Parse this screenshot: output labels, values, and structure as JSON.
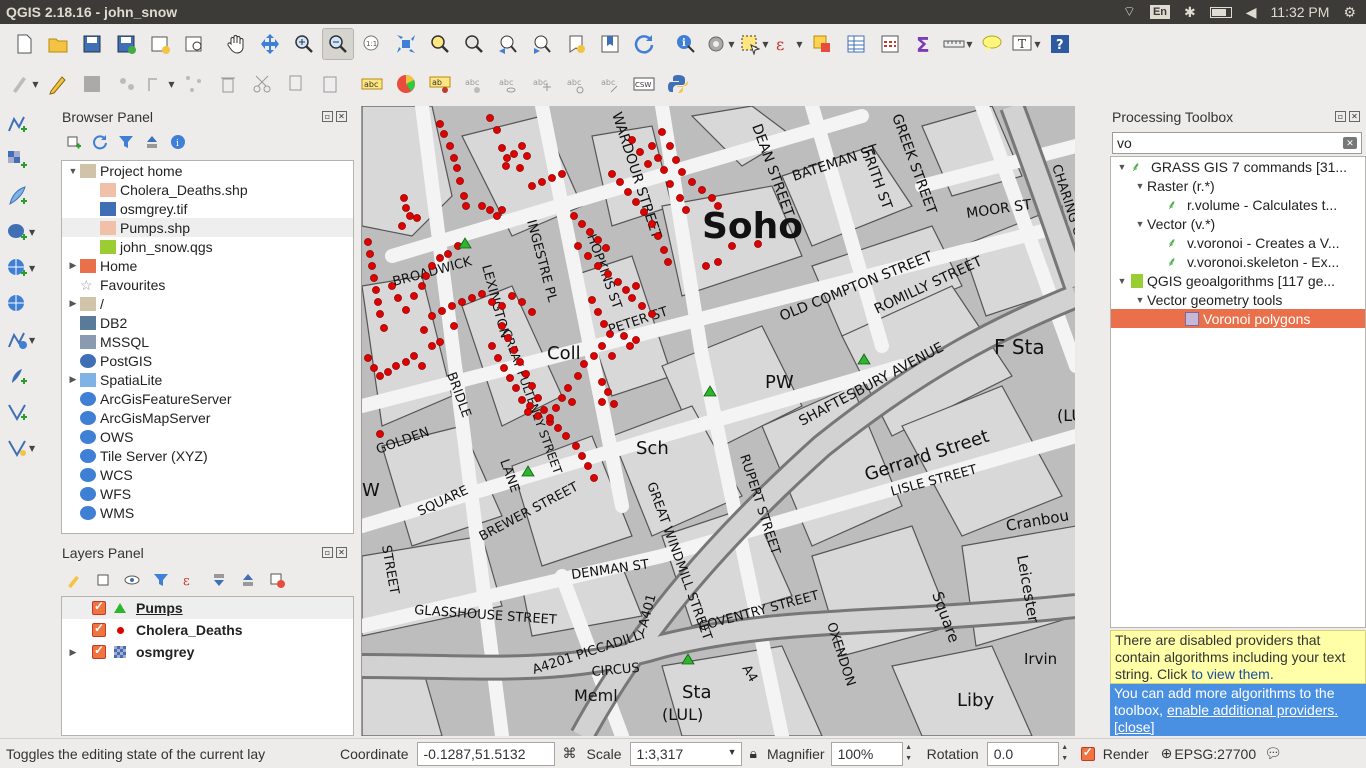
{
  "window": {
    "title": "QGIS 2.18.16 - john_snow"
  },
  "system_tray": {
    "language": "En",
    "clock": "11:32 PM"
  },
  "browser_panel": {
    "title": "Browser Panel",
    "items": [
      {
        "label": "Project home",
        "expander": "▼",
        "icon": "folder-icon"
      },
      {
        "label": "Cholera_Deaths.shp",
        "icon": "polygon-layer-icon",
        "indent": 2
      },
      {
        "label": "osmgrey.tif",
        "icon": "raster-icon",
        "indent": 2
      },
      {
        "label": "Pumps.shp",
        "icon": "polygon-layer-icon",
        "indent": 2,
        "selected": true
      },
      {
        "label": "john_snow.qgs",
        "icon": "qgis-project-icon",
        "indent": 2
      },
      {
        "label": "Home",
        "expander": "▶",
        "icon": "home-folder-icon"
      },
      {
        "label": "Favourites",
        "icon": "star-icon"
      },
      {
        "label": "/",
        "expander": "▶",
        "icon": "folder-icon"
      },
      {
        "label": "DB2",
        "icon": "db2-icon"
      },
      {
        "label": "MSSQL",
        "icon": "mssql-icon"
      },
      {
        "label": "PostGIS",
        "icon": "postgis-icon"
      },
      {
        "label": "SpatiaLite",
        "expander": "▶",
        "icon": "spatialite-icon"
      },
      {
        "label": "ArcGisFeatureServer",
        "icon": "globe-icon"
      },
      {
        "label": "ArcGisMapServer",
        "icon": "globe-icon"
      },
      {
        "label": "OWS",
        "icon": "globe-icon"
      },
      {
        "label": "Tile Server (XYZ)",
        "icon": "globe-icon"
      },
      {
        "label": "WCS",
        "icon": "globe-icon"
      },
      {
        "label": "WFS",
        "icon": "globe-icon"
      },
      {
        "label": "WMS",
        "icon": "globe-icon"
      }
    ]
  },
  "layers_panel": {
    "title": "Layers Panel",
    "layers": [
      {
        "label": "Pumps",
        "symbol": "green-triangle",
        "expander": ""
      },
      {
        "label": "Cholera_Deaths",
        "symbol": "red-dot",
        "expander": ""
      },
      {
        "label": "osmgrey",
        "symbol": "raster",
        "expander": "▶"
      }
    ]
  },
  "map": {
    "labels": [
      "Soho",
      "MOOR ST",
      "BATEMAN ST",
      "FRITH ST",
      "GREEK STREET",
      "DEAN STREET",
      "WARDOUR STREET",
      "OLD COMPTON STREET",
      "ROMILLY STREET",
      "SHAFTESBURY AVENUE",
      "Gerrard Street",
      "LISLE STREET",
      "F Sta",
      "PW",
      "Coll",
      "Sch",
      "Cranbou",
      "Leicester",
      "Square",
      "Irvin",
      "Liby",
      "BROADWICK",
      "GOLDEN",
      "SQUARE",
      "BRIDLE",
      "LANE",
      "BREWER STREET",
      "GREAT WINDMILL STREET",
      "RUPERT STREET",
      "DENMAN ST",
      "GLASSHOUSE STREET",
      "A4201 PICCADILLY",
      "CIRCUS",
      "COVENTRY STREET",
      "OXENDON",
      "A401",
      "A4",
      "Meml",
      "Sta",
      "(LUL)",
      "PETER ST",
      "HOPKINS ST",
      "INGESTRE PL",
      "LEXINGTON",
      "GREAT PULTENEY STREET",
      "CHARING CR",
      "W",
      "STREET",
      "(LU"
    ]
  },
  "processing_toolbox": {
    "title": "Processing Toolbox",
    "search_value": "vo",
    "tree": [
      {
        "label": "GRASS GIS 7 commands [31...",
        "expander": "▼",
        "level": 0,
        "icon": "grass-icon"
      },
      {
        "label": "Raster (r.*)",
        "expander": "▼",
        "level": 1
      },
      {
        "label": "r.volume - Calculates t...",
        "level": 2,
        "icon": "grass-icon"
      },
      {
        "label": "Vector (v.*)",
        "expander": "▼",
        "level": 1
      },
      {
        "label": "v.voronoi - Creates a V...",
        "level": 2,
        "icon": "grass-icon"
      },
      {
        "label": "v.voronoi.skeleton - Ex...",
        "level": 2,
        "icon": "grass-icon"
      },
      {
        "label": "QGIS geoalgorithms [117 ge...",
        "expander": "▼",
        "level": 0,
        "icon": "qgis-icon"
      },
      {
        "label": "Vector geometry tools",
        "expander": "▼",
        "level": 1
      },
      {
        "label": "Voronoi polygons",
        "level": 3,
        "icon": "voronoi-icon",
        "selected": true
      }
    ],
    "notice_disabled": {
      "text": "There are disabled providers that contain algorithms including your text string. Click",
      "link": "to view them."
    },
    "notice_more": {
      "text": "You can add more algorithms to the toolbox,",
      "link1": "enable additional providers.",
      "link2": "[close]"
    }
  },
  "status_bar": {
    "message": "Toggles the editing state of the current lay",
    "coordinate_label": "Coordinate",
    "coordinate_value": "-0.1287,51.5132",
    "scale_label": "Scale",
    "scale_value": "1:3,317",
    "magnifier_label": "Magnifier",
    "magnifier_value": "100%",
    "rotation_label": "Rotation",
    "rotation_value": "0.0",
    "render_label": "Render",
    "crs": "EPSG:27700"
  },
  "colors": {
    "accent": "#e9704a",
    "pump": "#2db52d",
    "death": "#e00000",
    "info_yellow": "#ffffa8",
    "info_blue": "#4a90e2"
  }
}
